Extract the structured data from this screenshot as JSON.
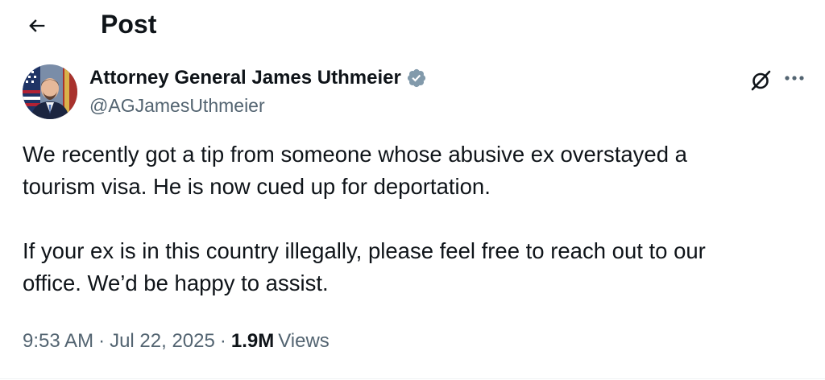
{
  "header": {
    "back_icon": "arrow-left-icon",
    "title": "Post"
  },
  "author": {
    "name": "Attorney General James Uthmeier",
    "handle": "@AGJamesUthmeier",
    "verified_icon": "verified-badge-icon",
    "verified_color": "#829aab"
  },
  "actions": {
    "grok_icon": "grok-icon",
    "more_icon": "more-horizontal-icon"
  },
  "post": {
    "paragraph_1": "We recently got a tip from someone whose abusive ex overstayed a\ntourism visa. He is now cued up for deportation.",
    "paragraph_2": "If your ex is in this country illegally, please feel free to reach out to our\noffice. We’d be happy to assist."
  },
  "meta": {
    "time": "9:53 AM",
    "separator": "·",
    "date": "Jul 22, 2025",
    "views_count": "1.9M",
    "views_label": "Views"
  },
  "colors": {
    "text_primary": "#0f1419",
    "text_secondary": "#536471"
  }
}
